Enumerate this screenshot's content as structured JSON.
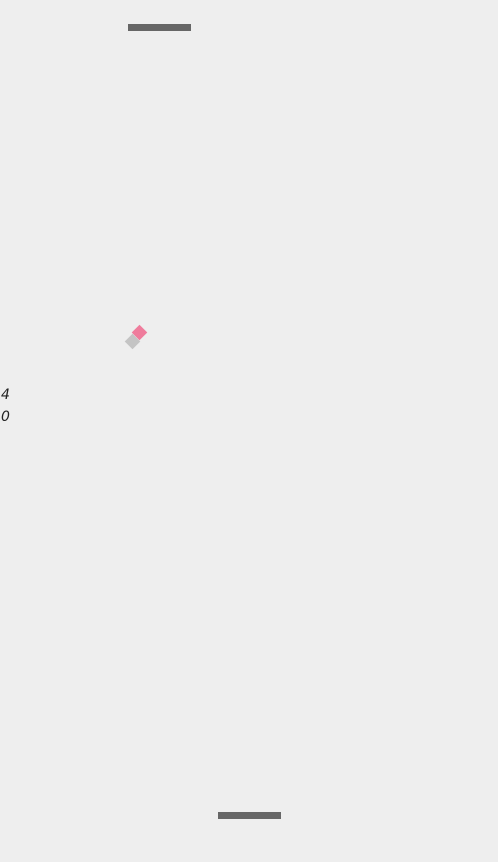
{
  "game": {
    "background_color": "#eeeeee",
    "paddle_color": "#666666",
    "ball_color": "#ef7c9c",
    "ball_trail_color": "#c4c4c4",
    "scores": {
      "top": "4",
      "bottom": "0"
    }
  }
}
